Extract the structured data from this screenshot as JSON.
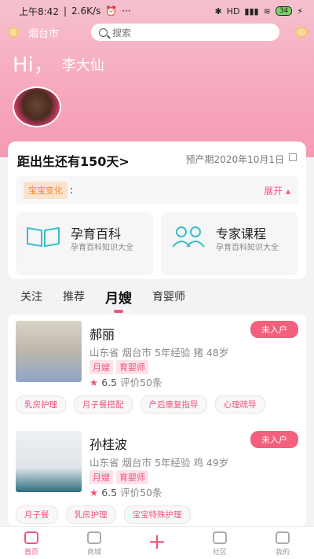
{
  "statusbar": {
    "time": "上午8:42",
    "speed": "2.6K/s",
    "dots": "···",
    "signal": "HD",
    "battery": "34"
  },
  "topbar": {
    "city": "烟台市",
    "search_placeholder": "搜索"
  },
  "greeting": {
    "hi": "Hi，",
    "name": "李大仙"
  },
  "pregnancy": {
    "days_text": "距出生还有150天>",
    "due_date": "预产期2020年10月1日",
    "change_tag": "宝宝变化",
    "colon": ":",
    "expand": "展开 ▴"
  },
  "features": [
    {
      "title": "孕育百科",
      "subtitle": "孕育百科知识大全",
      "icon": "book-icon"
    },
    {
      "title": "专家课程",
      "subtitle": "孕育百科知识大全",
      "icon": "people-icon"
    }
  ],
  "tabs": [
    "关注",
    "推荐",
    "月嫂",
    "育婴师"
  ],
  "active_tab": "月嫂",
  "nannies": [
    {
      "name": "郝丽",
      "status": "未入户",
      "info": "山东省  烟台市  5年经验  猪  48岁",
      "roles": [
        "月嫂",
        "育婴师"
      ],
      "star": "★",
      "score": "6.5",
      "reviews": "评价50条",
      "services": [
        "乳房护理",
        "月子餐搭配",
        "产后康复指导",
        "心理疏导"
      ]
    },
    {
      "name": "孙桂波",
      "status": "未入户",
      "info": "山东省  烟台市  5年经验  鸡  49岁",
      "roles": [
        "月嫂",
        "育婴师"
      ],
      "star": "★",
      "score": "6.5",
      "reviews": "评价50条",
      "services": [
        "月子餐",
        "乳房护理",
        "宝宝特殊护理"
      ]
    }
  ],
  "bottom_nav": [
    {
      "label": "首页",
      "icon": "home-icon"
    },
    {
      "label": "商城",
      "icon": "shop-icon"
    },
    {
      "label": "+",
      "icon": "plus-icon"
    },
    {
      "label": "社区",
      "icon": "community-icon"
    },
    {
      "label": "我的",
      "icon": "profile-icon"
    }
  ],
  "colors": {
    "accent": "#f0567c",
    "header_pink": "#f7a9bd",
    "tag_orange": "#f08a35"
  }
}
